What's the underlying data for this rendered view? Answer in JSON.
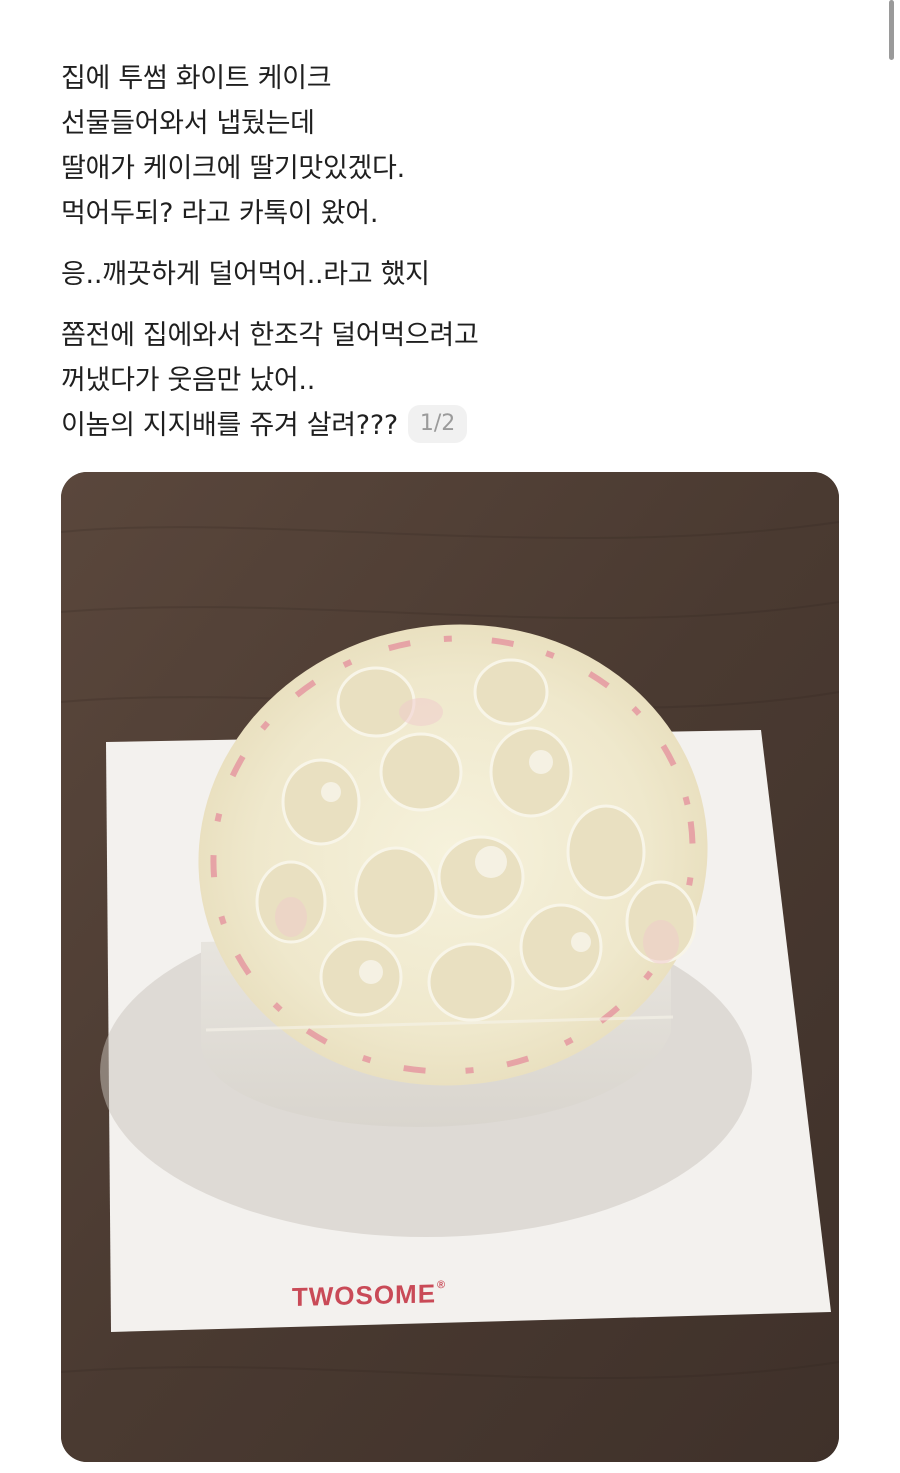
{
  "post": {
    "paragraphs": [
      {
        "lines": [
          "집에 투썸 화이트 케이크",
          "선물들어와서 냅뒀는데",
          "딸애가 케이크에 딸기맛있겠다.",
          "먹어두되? 라고 카톡이 왔어."
        ]
      },
      {
        "lines": [
          "응..깨끗하게 덜어먹어..라고 했지"
        ]
      },
      {
        "lines": [
          "쫌전에 집에와서 한조각 덜어먹으려고",
          "꺼냈다가 웃음만 났어..",
          "이놈의 지지배를 쥬겨 살려???"
        ]
      }
    ],
    "image_counter": "1/2"
  },
  "photo": {
    "brand_text": "TWOSOME",
    "brand_mark": "®",
    "colors": {
      "table": "#4a3a31",
      "board": "#f3f1ee",
      "cream": "#f2ecd2",
      "strawberry_trace": "#e4899a",
      "brand": "#c94a57"
    }
  }
}
